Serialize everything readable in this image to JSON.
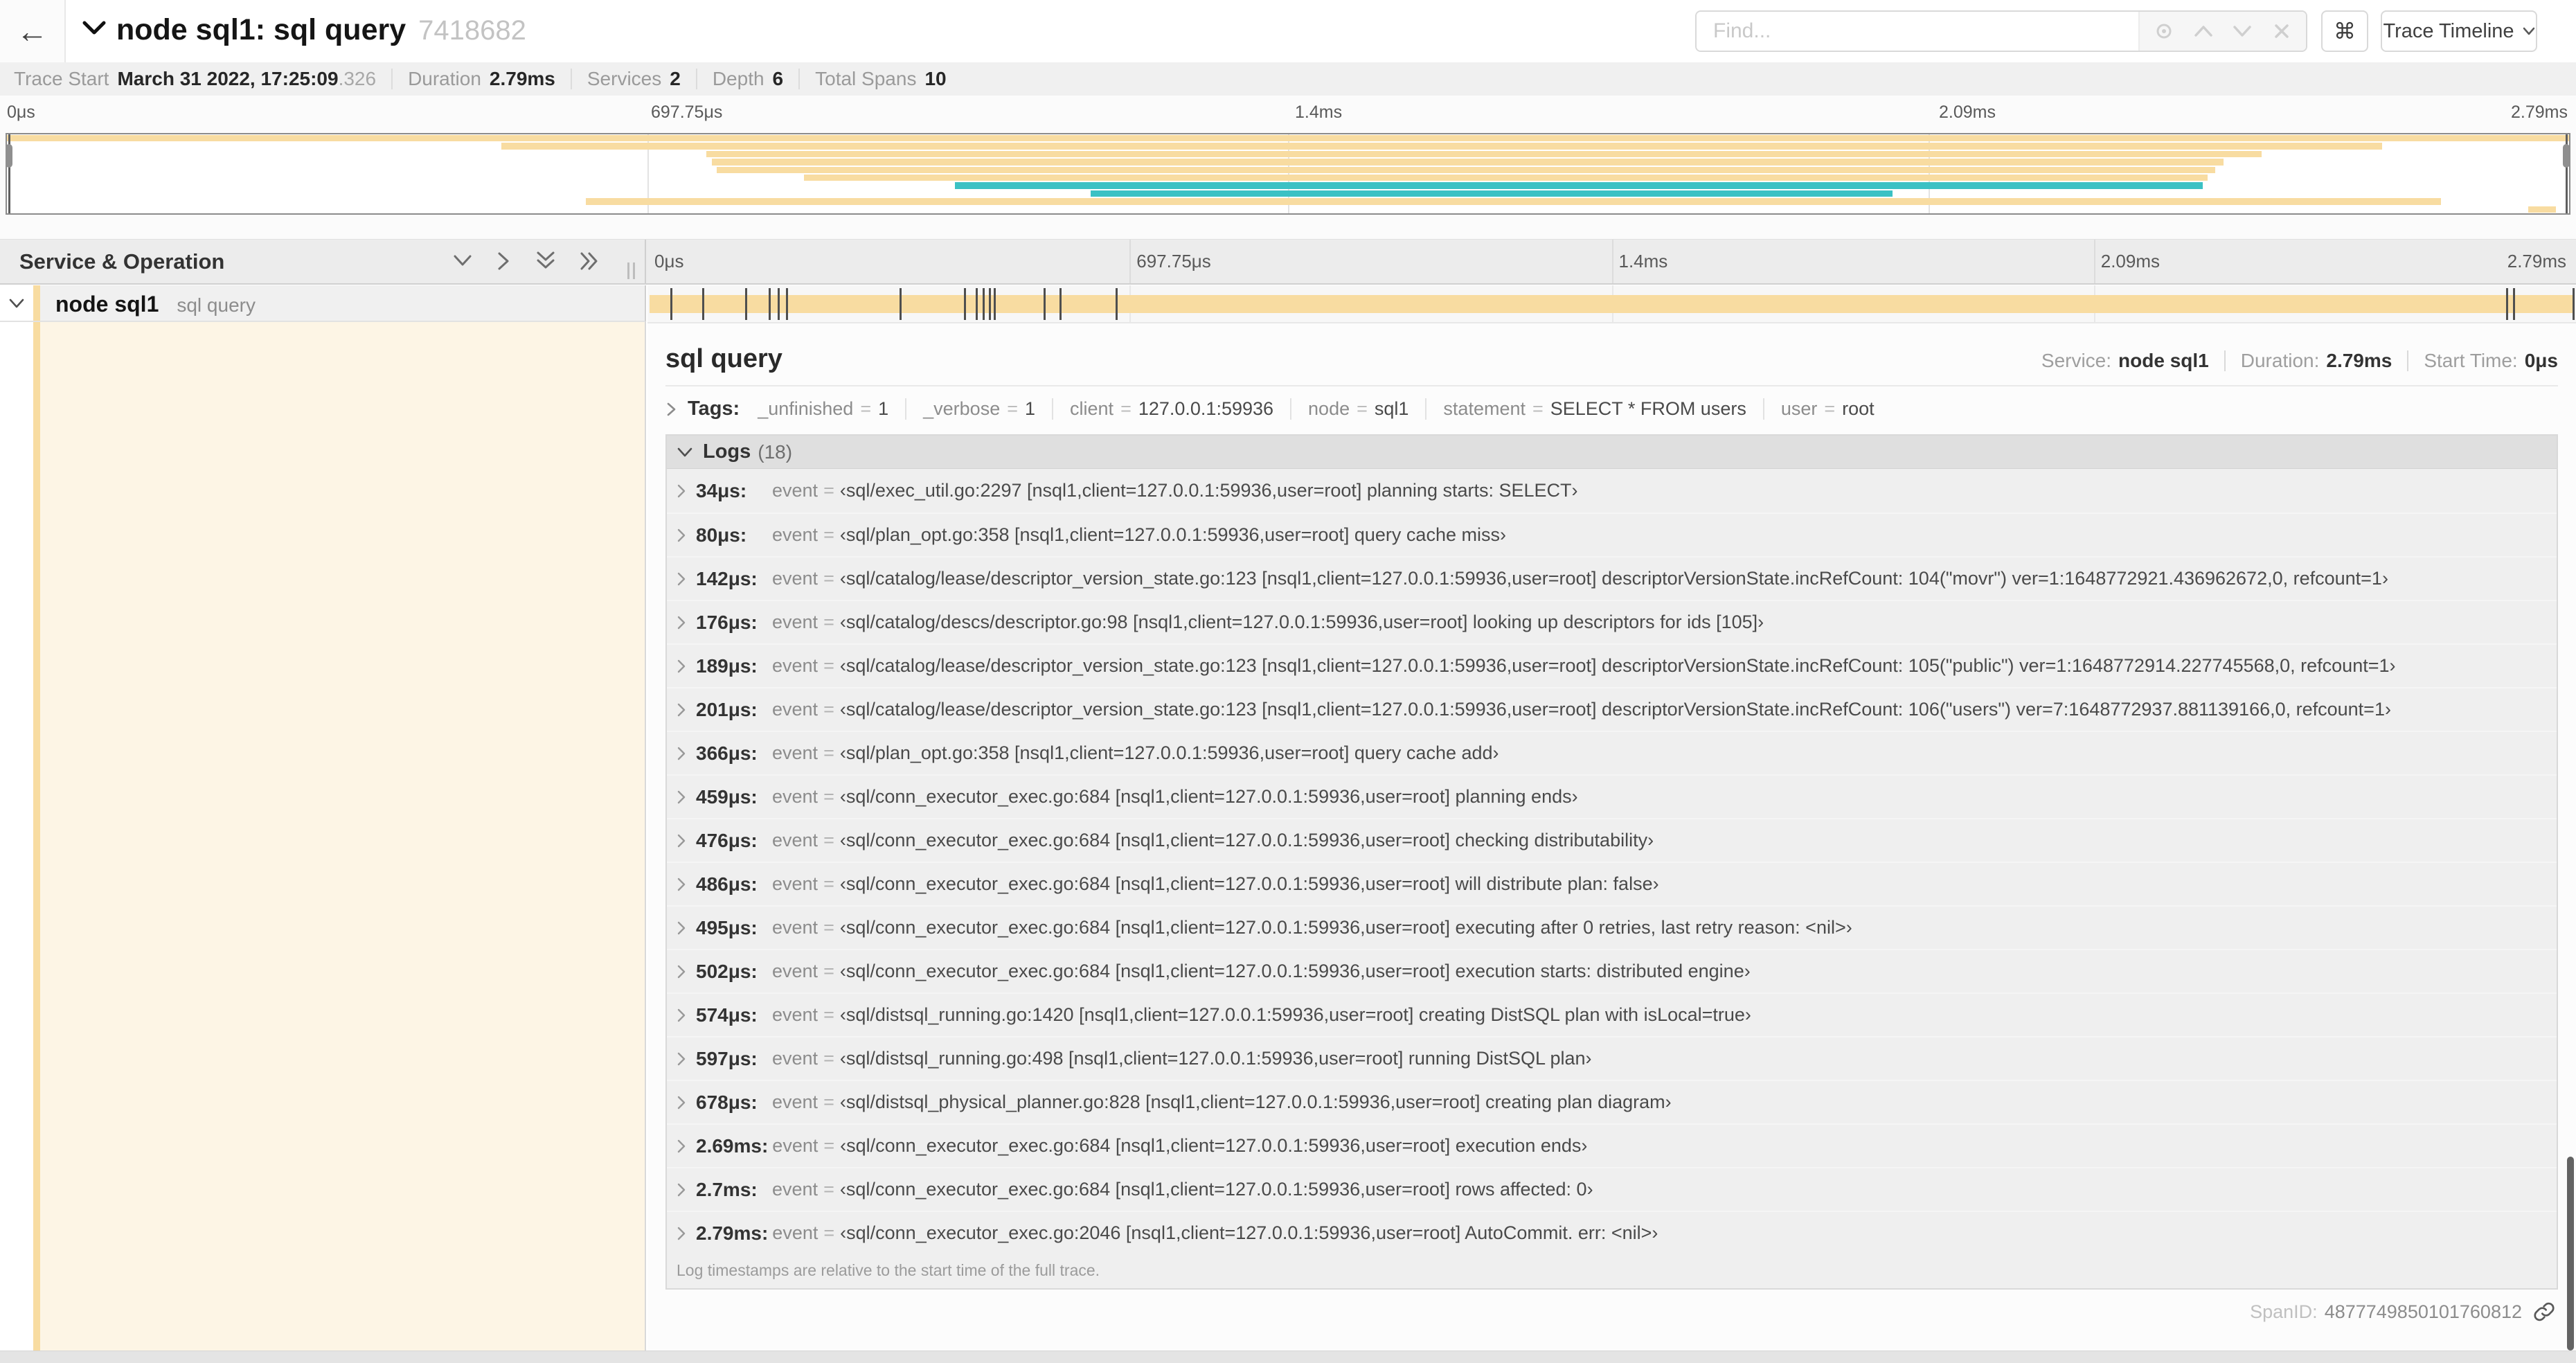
{
  "colors": {
    "tan": "#F8DCA1",
    "teal": "#3BC1C4",
    "cream": "#FDF5E5"
  },
  "topbar": {
    "back_icon": "←",
    "title": "node sql1: sql query",
    "trace_id": "7418682",
    "find_placeholder": "Find...",
    "shortcut_key": "⌘",
    "view_selector": "Trace Timeline"
  },
  "trace_info": {
    "items": [
      {
        "label": "Trace Start",
        "value": "March 31 2022, 17:25:09",
        "suffix": ".326"
      },
      {
        "label": "Duration",
        "value": "2.79ms"
      },
      {
        "label": "Services",
        "value": "2"
      },
      {
        "label": "Depth",
        "value": "6"
      },
      {
        "label": "Total Spans",
        "value": "10"
      }
    ]
  },
  "timeline": {
    "duration_us": 2790,
    "ticks": [
      "0μs",
      "697.75μs",
      "1.4ms",
      "2.09ms",
      "2.79ms"
    ],
    "left_header": "Service & Operation",
    "row": {
      "service": "node sql1",
      "operation": "sql query",
      "bar_start_pct": 0.1,
      "bar_end_pct": 99.9,
      "color": "tan"
    }
  },
  "minimap": {
    "spans": [
      {
        "start_pct": 0,
        "end_pct": 100,
        "color": "tan"
      },
      {
        "start_pct": 19.3,
        "end_pct": 92.7,
        "color": "tan"
      },
      {
        "start_pct": 27.3,
        "end_pct": 88.0,
        "color": "tan"
      },
      {
        "start_pct": 27.5,
        "end_pct": 86.5,
        "color": "tan"
      },
      {
        "start_pct": 27.7,
        "end_pct": 86.2,
        "color": "tan"
      },
      {
        "start_pct": 31.1,
        "end_pct": 85.9,
        "color": "tan"
      },
      {
        "start_pct": 37.0,
        "end_pct": 85.7,
        "color": "teal"
      },
      {
        "start_pct": 42.3,
        "end_pct": 73.6,
        "color": "teal"
      },
      {
        "start_pct": 22.6,
        "end_pct": 95.0,
        "color": "tan"
      },
      {
        "start_pct": 98.4,
        "end_pct": 99.5,
        "color": "tan"
      }
    ]
  },
  "detail": {
    "title": "sql query",
    "service_label": "Service:",
    "service": "node sql1",
    "duration_label": "Duration:",
    "duration": "2.79ms",
    "start_label": "Start Time:",
    "start": "0μs",
    "tags_label": "Tags:",
    "tags": [
      {
        "key": "_unfinished",
        "value": "1"
      },
      {
        "key": "_verbose",
        "value": "1"
      },
      {
        "key": "client",
        "value": "127.0.0.1:59936"
      },
      {
        "key": "node",
        "value": "sql1"
      },
      {
        "key": "statement",
        "value": "SELECT * FROM users"
      },
      {
        "key": "user",
        "value": "root"
      }
    ],
    "logs_label": "Logs",
    "logs_count": "(18)",
    "logs": [
      {
        "time": "34μs:",
        "us": 34,
        "key": "event",
        "value": "‹sql/exec_util.go:2297 [nsql1,client=127.0.0.1:59936,user=root] planning starts: SELECT›"
      },
      {
        "time": "80μs:",
        "us": 80,
        "key": "event",
        "value": "‹sql/plan_opt.go:358 [nsql1,client=127.0.0.1:59936,user=root] query cache miss›"
      },
      {
        "time": "142μs:",
        "us": 142,
        "key": "event",
        "value": "‹sql/catalog/lease/descriptor_version_state.go:123 [nsql1,client=127.0.0.1:59936,user=root] descriptorVersionState.incRefCount: 104(\"movr\") ver=1:1648772921.436962672,0, refcount=1›"
      },
      {
        "time": "176μs:",
        "us": 176,
        "key": "event",
        "value": "‹sql/catalog/descs/descriptor.go:98 [nsql1,client=127.0.0.1:59936,user=root] looking up descriptors for ids [105]›"
      },
      {
        "time": "189μs:",
        "us": 189,
        "key": "event",
        "value": "‹sql/catalog/lease/descriptor_version_state.go:123 [nsql1,client=127.0.0.1:59936,user=root] descriptorVersionState.incRefCount: 105(\"public\") ver=1:1648772914.227745568,0, refcount=1›"
      },
      {
        "time": "201μs:",
        "us": 201,
        "key": "event",
        "value": "‹sql/catalog/lease/descriptor_version_state.go:123 [nsql1,client=127.0.0.1:59936,user=root] descriptorVersionState.incRefCount: 106(\"users\") ver=7:1648772937.881139166,0, refcount=1›"
      },
      {
        "time": "366μs:",
        "us": 366,
        "key": "event",
        "value": "‹sql/plan_opt.go:358 [nsql1,client=127.0.0.1:59936,user=root] query cache add›"
      },
      {
        "time": "459μs:",
        "us": 459,
        "key": "event",
        "value": "‹sql/conn_executor_exec.go:684 [nsql1,client=127.0.0.1:59936,user=root] planning ends›"
      },
      {
        "time": "476μs:",
        "us": 476,
        "key": "event",
        "value": "‹sql/conn_executor_exec.go:684 [nsql1,client=127.0.0.1:59936,user=root] checking distributability›"
      },
      {
        "time": "486μs:",
        "us": 486,
        "key": "event",
        "value": "‹sql/conn_executor_exec.go:684 [nsql1,client=127.0.0.1:59936,user=root] will distribute plan: false›"
      },
      {
        "time": "495μs:",
        "us": 495,
        "key": "event",
        "value": "‹sql/conn_executor_exec.go:684 [nsql1,client=127.0.0.1:59936,user=root] executing after 0 retries, last retry reason: <nil>›"
      },
      {
        "time": "502μs:",
        "us": 502,
        "key": "event",
        "value": "‹sql/conn_executor_exec.go:684 [nsql1,client=127.0.0.1:59936,user=root] execution starts: distributed engine›"
      },
      {
        "time": "574μs:",
        "us": 574,
        "key": "event",
        "value": "‹sql/distsql_running.go:1420 [nsql1,client=127.0.0.1:59936,user=root] creating DistSQL plan with isLocal=true›"
      },
      {
        "time": "597μs:",
        "us": 597,
        "key": "event",
        "value": "‹sql/distsql_running.go:498 [nsql1,client=127.0.0.1:59936,user=root] running DistSQL plan›"
      },
      {
        "time": "678μs:",
        "us": 678,
        "key": "event",
        "value": "‹sql/distsql_physical_planner.go:828 [nsql1,client=127.0.0.1:59936,user=root] creating plan diagram›"
      },
      {
        "time": "2.69ms:",
        "us": 2690,
        "key": "event",
        "value": "‹sql/conn_executor_exec.go:684 [nsql1,client=127.0.0.1:59936,user=root] execution ends›"
      },
      {
        "time": "2.7ms:",
        "us": 2700,
        "key": "event",
        "value": "‹sql/conn_executor_exec.go:684 [nsql1,client=127.0.0.1:59936,user=root] rows affected: 0›"
      },
      {
        "time": "2.79ms:",
        "us": 2790,
        "key": "event",
        "value": "‹sql/conn_executor_exec.go:2046 [nsql1,client=127.0.0.1:59936,user=root] AutoCommit. err: <nil>›"
      }
    ],
    "logs_footer": "Log timestamps are relative to the start time of the full trace.",
    "span_id_label": "SpanID:",
    "span_id": "4877749850101760812"
  }
}
